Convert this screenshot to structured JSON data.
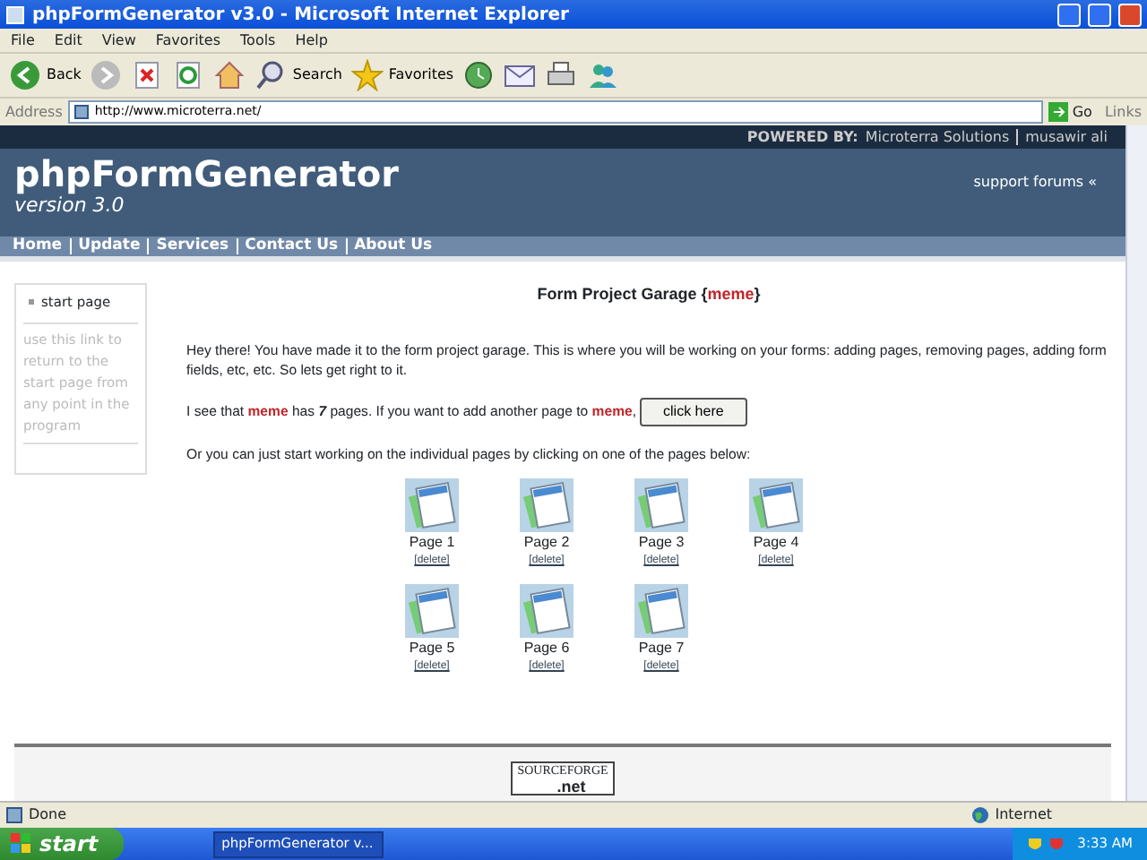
{
  "window": {
    "title": "phpFormGenerator v3.0 - Microsoft Internet Explorer"
  },
  "menu": [
    "File",
    "Edit",
    "View",
    "Favorites",
    "Tools",
    "Help"
  ],
  "toolbar": [
    {
      "kind": "back",
      "label": "Back"
    },
    {
      "kind": "forward"
    },
    {
      "kind": "stop"
    },
    {
      "kind": "refresh"
    },
    {
      "kind": "home"
    },
    {
      "kind": "search",
      "label": "Search"
    },
    {
      "kind": "favorites",
      "label": "Favorites"
    },
    {
      "kind": "history"
    },
    {
      "kind": "mail"
    },
    {
      "kind": "print"
    },
    {
      "kind": "messenger"
    }
  ],
  "address_bar": {
    "label": "Address",
    "url": "http://www.microterra.net/",
    "go": "Go",
    "links": "Links"
  },
  "page": {
    "powered_by": {
      "label": "POWERED BY:",
      "links": [
        "Microterra Solutions",
        "musawir ali"
      ]
    },
    "site_title": "phpFormGenerator",
    "version": "version 3.0",
    "support_link": "support forums «",
    "nav": [
      "Home",
      "Update",
      "Services",
      "Contact Us",
      "About Us"
    ],
    "sidebar": {
      "link": "start page",
      "help": "use this link to return to the start page from any point in the program"
    },
    "heading": [
      {
        "kind": "text",
        "text": "Form Project Garage {"
      },
      {
        "kind": "project",
        "text": "meme"
      },
      {
        "kind": "text",
        "text": "}"
      }
    ],
    "intro": "Hey there! You have made it to the form project garage. This is where you will be working on your forms: adding pages, removing pages, adding form fields, etc, etc. So lets get right to it.",
    "add_sentence": [
      {
        "kind": "text",
        "text": "I see that "
      },
      {
        "kind": "project",
        "text": "meme"
      },
      {
        "kind": "text",
        "text": " has "
      },
      {
        "kind": "count",
        "text": "7"
      },
      {
        "kind": "text",
        "text": " pages. If you want to add another page to "
      },
      {
        "kind": "project",
        "text": "meme"
      },
      {
        "kind": "text",
        "text": ","
      }
    ],
    "add_button": "click here",
    "pages_intro": "Or you can just start working on the individual pages by clicking on one of the pages below:",
    "pages": [
      {
        "label": "Page 1",
        "action": "[delete]"
      },
      {
        "label": "Page 2",
        "action": "[delete]"
      },
      {
        "label": "Page 3",
        "action": "[delete]"
      },
      {
        "label": "Page 4",
        "action": "[delete]"
      },
      {
        "label": "Page 5",
        "action": "[delete]"
      },
      {
        "label": "Page 6",
        "action": "[delete]"
      },
      {
        "label": "Page 7",
        "action": "[delete]"
      }
    ],
    "footer_logo": {
      "text": "SOURCEFORGE",
      "suffix": ".net"
    }
  },
  "status_bar": {
    "status": "Done",
    "zone": "Internet"
  },
  "taskbar": {
    "start": "start",
    "tasks": [
      "phpFormGenerator v..."
    ],
    "clock": "3:33 AM"
  }
}
